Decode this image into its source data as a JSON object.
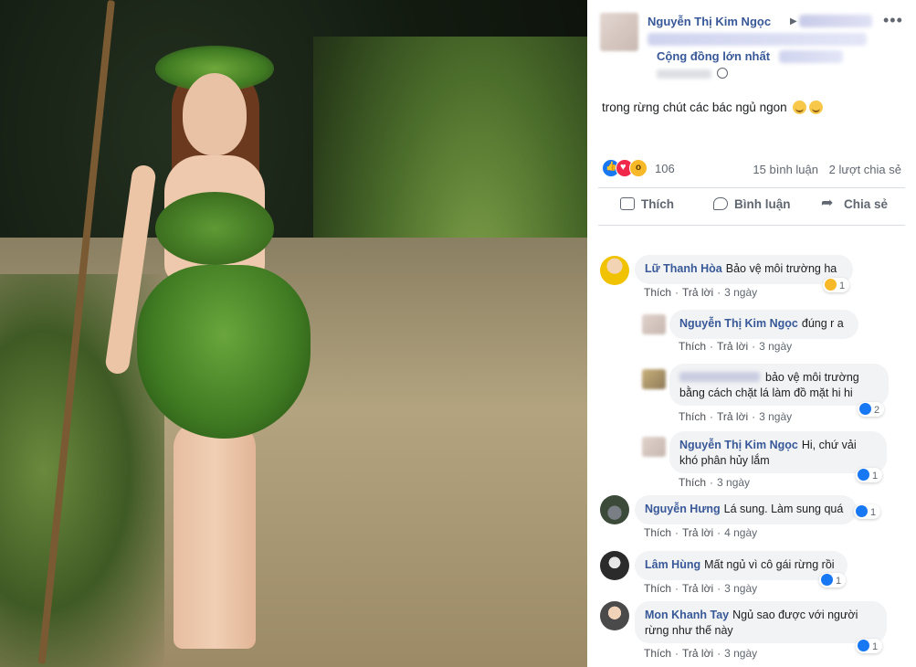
{
  "post": {
    "author": "Nguyễn Thị Kim Ngọc",
    "group_visible": "Cộng đồng lớn nhất",
    "text": "trong rừng chút các bác ngủ ngon",
    "reaction_count": "106",
    "comments_count": "15 bình luận",
    "shares_count": "2 lượt chia sẻ",
    "more_label": "•••"
  },
  "actions": {
    "like": "Thích",
    "comment": "Bình luận",
    "share": "Chia sẻ"
  },
  "comments": [
    {
      "name": "Lữ Thanh Hòa",
      "text": "Bảo vệ môi trường ha",
      "like": "Thích",
      "reply": "Trả lời",
      "time": "3 ngày",
      "reactions": "1",
      "reaction_type": "haha"
    },
    {
      "name": "Nguyễn Thị Kim Ngọc",
      "text": "đúng r a",
      "like": "Thích",
      "reply": "Trả lời",
      "time": "3 ngày"
    },
    {
      "name": "",
      "text": "bảo vệ môi trường bằng cách chặt lá làm đồ mặt hi hi",
      "like": "Thích",
      "reply": "Trả lời",
      "time": "3 ngày",
      "reactions": "2"
    },
    {
      "name": "Nguyễn Thị Kim Ngọc",
      "text": "Hi, chứ vải khó phân hủy lắm",
      "like": "Thích",
      "time": "3 ngày",
      "reactions": "1"
    },
    {
      "name": "Nguyễn Hưng",
      "text": "Lá sung. Làm sung quá",
      "like": "Thích",
      "reply": "Trả lời",
      "time": "4 ngày",
      "reactions": "1"
    },
    {
      "name": "Lâm Hùng",
      "text": "Mất ngủ vì cô gái rừng rồi",
      "like": "Thích",
      "reply": "Trả lời",
      "time": "3 ngày",
      "reactions": "1"
    },
    {
      "name": "Mon Khanh Tay",
      "text": "Ngủ sao được với người rừng như thế này",
      "like": "Thích",
      "reply": "Trả lời",
      "time": "3 ngày",
      "reactions": "1"
    }
  ],
  "colors": {
    "link": "#385898",
    "meta": "#606770",
    "bubble": "#f2f3f5",
    "like_blue": "#1877f2"
  }
}
